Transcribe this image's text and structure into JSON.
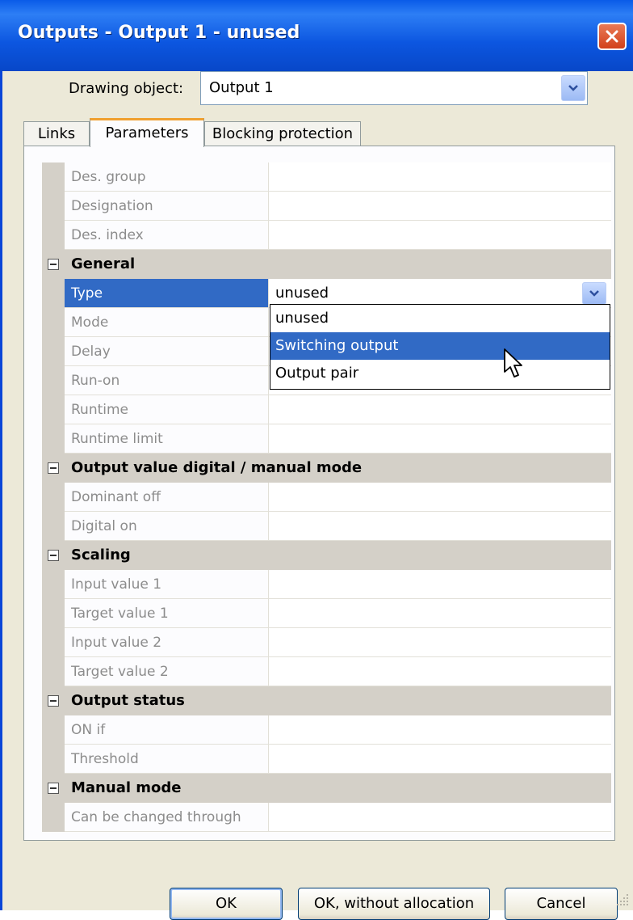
{
  "window": {
    "title": "Outputs - Output 1 - unused"
  },
  "drawing_object": {
    "label": "Drawing object:",
    "value": "Output 1"
  },
  "tabs": [
    {
      "label": "Links"
    },
    {
      "label": "Parameters"
    },
    {
      "label": "Blocking protection"
    }
  ],
  "grid": {
    "top_rows": [
      "Des. group",
      "Designation",
      "Des. index"
    ],
    "general": {
      "title": "General",
      "type_label": "Type",
      "type_value": "unused",
      "rows": [
        "Mode",
        "Delay",
        "Run-on",
        "Runtime",
        "Runtime limit"
      ]
    },
    "output_value": {
      "title": "Output value digital / manual mode",
      "rows": [
        "Dominant off",
        "Digital on"
      ]
    },
    "scaling": {
      "title": "Scaling",
      "rows": [
        "Input value 1",
        "Target value 1",
        "Input value 2",
        "Target value 2"
      ]
    },
    "output_status": {
      "title": "Output status",
      "rows": [
        "ON if",
        "Threshold"
      ]
    },
    "manual_mode": {
      "title": "Manual mode",
      "rows": [
        "Can be changed through"
      ]
    }
  },
  "type_dropdown": {
    "options": [
      "unused",
      "Switching output",
      "Output pair"
    ],
    "highlighted": "Switching output"
  },
  "buttons": {
    "ok": "OK",
    "ok_without_allocation": "OK, without allocation",
    "cancel": "Cancel"
  },
  "colors": {
    "titlebar": "#0a5be8",
    "selection": "#316ac5",
    "category_bg": "#d4d0c8",
    "dialog_bg": "#ece9d8",
    "close_button": "#d2401a"
  }
}
